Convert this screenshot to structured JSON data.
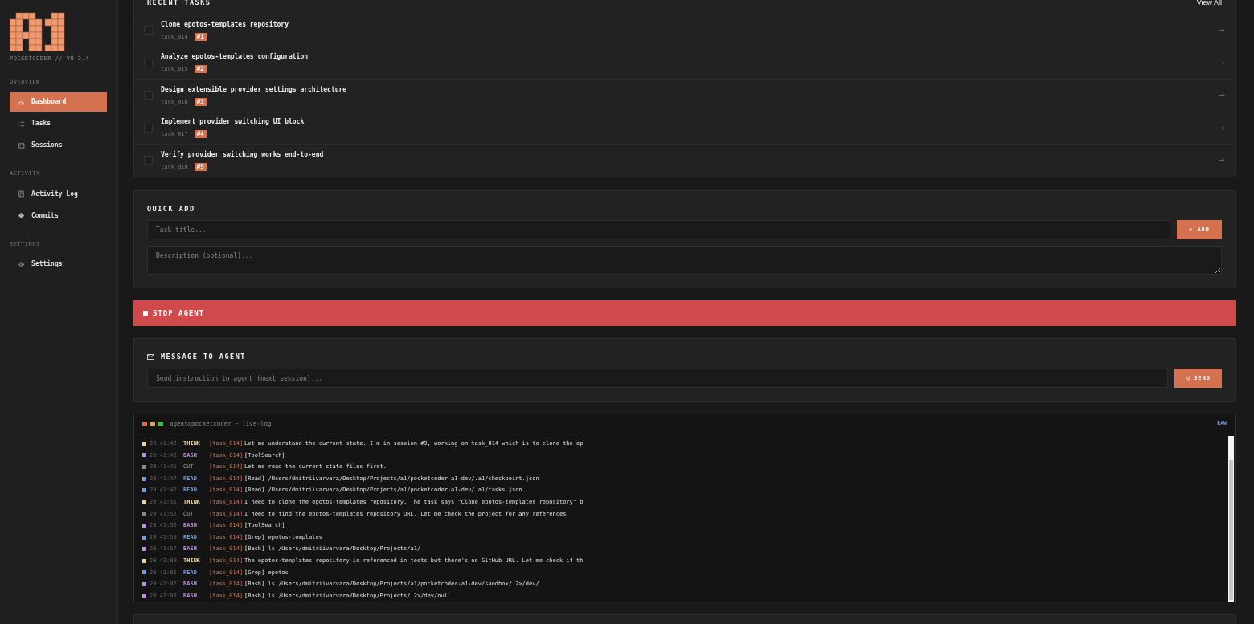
{
  "sidebar": {
    "version": "POCKETCODER // V0.2.4",
    "sections": [
      {
        "title": "OVERVIEW",
        "items": [
          {
            "label": "Dashboard",
            "selected": true
          },
          {
            "label": "Tasks",
            "selected": false
          },
          {
            "label": "Sessions",
            "selected": false
          }
        ]
      },
      {
        "title": "ACTIVITY",
        "items": [
          {
            "label": "Activity Log",
            "selected": false
          },
          {
            "label": "Commits",
            "selected": false
          }
        ]
      },
      {
        "title": "SETTINGS",
        "items": [
          {
            "label": "Settings",
            "selected": false
          }
        ]
      }
    ]
  },
  "recent_tasks": {
    "title": "RECENT TASKS",
    "link": "View All",
    "tasks": [
      {
        "title": "Clone epotos-templates repository",
        "id": "task_014",
        "badge": "#1",
        "checked": false
      },
      {
        "title": "Analyze epotos-templates configuration",
        "id": "task_015",
        "badge": "#2",
        "checked": false
      },
      {
        "title": "Design extensible provider settings architecture",
        "id": "task_016",
        "badge": "#3",
        "checked": false
      },
      {
        "title": "Implement provider switching UI block",
        "id": "task_017",
        "badge": "#4",
        "checked": false
      },
      {
        "title": "Verify provider switching works end-to-end",
        "id": "task_018",
        "badge": "#5",
        "checked": false
      }
    ]
  },
  "quick_add": {
    "title": "QUICK ADD",
    "title_placeholder": "Task title...",
    "description_placeholder": "Description (optional)...",
    "button": "+ ADD"
  },
  "stop_button": "STOP AGENT",
  "message": {
    "title": "MESSAGE TO AGENT",
    "placeholder": "Send instruction to agent (next session)...",
    "button": "SEND"
  },
  "log": {
    "title": "agent@pocketcoder ~ live-log",
    "mode": "RAW",
    "lines": [
      {
        "time": "20:41:42",
        "kind": "think",
        "tag": "THINK",
        "task": "[task_014]",
        "text": "Let me understand the current state. I'm in session #9, working on task_014 which is to clone the ep"
      },
      {
        "time": "20:41:43",
        "kind": "bash",
        "tag": "BASH",
        "task": "[task_014]",
        "text": "[ToolSearch]"
      },
      {
        "time": "20:41:45",
        "kind": "out",
        "tag": "OUT",
        "task": "[task_014]",
        "text": "Let me read the current state files first."
      },
      {
        "time": "20:41:47",
        "kind": "read",
        "tag": "READ",
        "task": "[task_014]",
        "text": "[Read] /Users/dmitriivarvara/Desktop/Projects/a1/pocketcoder-a1-dev/.a1/checkpoint.json"
      },
      {
        "time": "20:41:47",
        "kind": "read",
        "tag": "READ",
        "task": "[task_014]",
        "text": "[Read] /Users/dmitriivarvara/Desktop/Projects/a1/pocketcoder-a1-dev/.a1/tasks.json"
      },
      {
        "time": "20:41:51",
        "kind": "think",
        "tag": "THINK",
        "task": "[task_014]",
        "text": "I need to clone the epotos-templates repository. The task says \"Clone epotos-templates repository\" b"
      },
      {
        "time": "20:41:52",
        "kind": "out",
        "tag": "OUT",
        "task": "[task_014]",
        "text": "I need to find the epotos-templates repository URL. Let me check the project for any references."
      },
      {
        "time": "20:41:52",
        "kind": "bash",
        "tag": "BASH",
        "task": "[task_014]",
        "text": "[ToolSearch]"
      },
      {
        "time": "20:41:55",
        "kind": "read",
        "tag": "READ",
        "task": "[task_014]",
        "text": "[Grep] epotos-templates"
      },
      {
        "time": "20:41:57",
        "kind": "bash",
        "tag": "BASH",
        "task": "[task_014]",
        "text": "[Bash] ls /Users/dmitriivarvara/Desktop/Projects/a1/"
      },
      {
        "time": "20:42:00",
        "kind": "think",
        "tag": "THINK",
        "task": "[task_014]",
        "text": "The epotos-templates repository is referenced in tests but there's no GitHub URL. Let me check if th"
      },
      {
        "time": "20:42:01",
        "kind": "read",
        "tag": "READ",
        "task": "[task_014]",
        "text": "[Grep] epotos"
      },
      {
        "time": "20:42:02",
        "kind": "bash",
        "tag": "BASH",
        "task": "[task_014]",
        "text": "[Bash] ls /Users/dmitriivarvara/Desktop/Projects/a1/pocketcoder-a1-dev/sandbox/ 2>/dev/"
      },
      {
        "time": "20:42:03",
        "kind": "bash",
        "tag": "BASH",
        "task": "[task_014]",
        "text": "[Bash] ls /Users/dmitriivarvara/Desktop/Projects/ 2>/dev/null"
      }
    ]
  }
}
